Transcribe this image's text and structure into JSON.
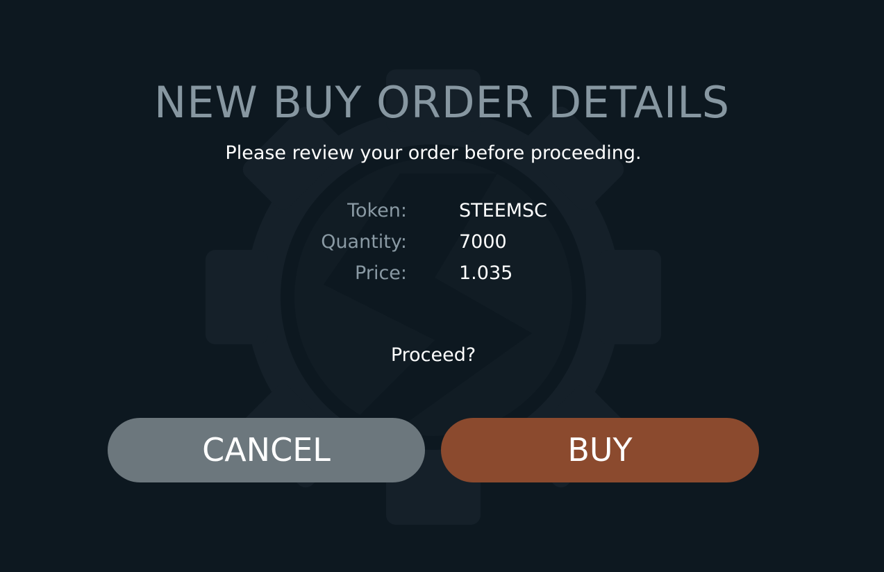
{
  "dialog": {
    "title": "NEW BUY ORDER DETAILS",
    "subtitle": "Please review your order before proceeding.",
    "details": [
      {
        "label": "Token:",
        "value": "STEEMSC"
      },
      {
        "label": "Quantity:",
        "value": "7000"
      },
      {
        "label": "Price:",
        "value": "1.035"
      }
    ],
    "prompt": "Proceed?",
    "cancel_label": "CANCEL",
    "buy_label": "BUY"
  },
  "colors": {
    "background": "#0d1820",
    "title": "#8797a1",
    "cancel_button": "#6c777d",
    "buy_button": "#8b4a2e"
  },
  "icons": {
    "background": "gear-logo-icon"
  }
}
